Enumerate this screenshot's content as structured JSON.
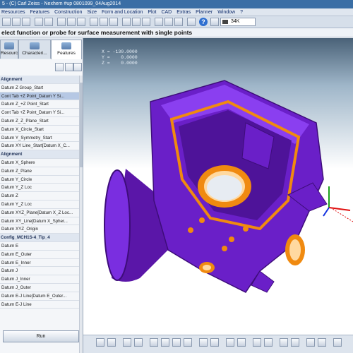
{
  "window": {
    "title": "5 - (C) Carl Zeiss - Nexhem #up 0801099_04Aug2014"
  },
  "menu": [
    "Resources",
    "Features",
    "Construction",
    "Size",
    "Form and Location",
    "Plot",
    "CAD",
    "Extras",
    "Planner",
    "Window",
    "?"
  ],
  "toolbar": {
    "combo_value": "34K"
  },
  "prompt": "elect function or probe for surface measurement with single points",
  "tabs": [
    "Resourc...",
    "Characteri...",
    "Features"
  ],
  "tree": [
    {
      "text": "Alignment",
      "kind": "section"
    },
    {
      "text": "Datum Z Group_Start",
      "kind": "item"
    },
    {
      "text": "Cont Tab +Z Point_Datum Y Si...",
      "kind": "selected"
    },
    {
      "text": "Datum Z_+Z Point_Start",
      "kind": "item"
    },
    {
      "text": "Cont Tab +Z Point_Datum Y Si...",
      "kind": "item"
    },
    {
      "text": "Datum Z_Z_Plane_Start",
      "kind": "item"
    },
    {
      "text": "Datum X_Circle_Start",
      "kind": "item"
    },
    {
      "text": "Datum Y_Symmetry_Start",
      "kind": "item"
    },
    {
      "text": "Datum XY Line_Start[Datum X_C...",
      "kind": "item"
    },
    {
      "text": "Alignment",
      "kind": "section"
    },
    {
      "text": "Datum X_Sphere",
      "kind": "item"
    },
    {
      "text": "Datum Z_Plane",
      "kind": "item"
    },
    {
      "text": "Datum Y_Circle",
      "kind": "item"
    },
    {
      "text": "Datum Y_Z Loc",
      "kind": "item"
    },
    {
      "text": "Datum Z",
      "kind": "item"
    },
    {
      "text": "Datum Y_Z Loc",
      "kind": "item"
    },
    {
      "text": "Datum XYZ_Plane[Datum X_Z Loc...",
      "kind": "item"
    },
    {
      "text": "Datum XY_Line[Datum X_Spher...",
      "kind": "item"
    },
    {
      "text": "Datum XYZ_Origin",
      "kind": "item"
    },
    {
      "text": "Config_MCH1S-4_Tip_4",
      "kind": "section"
    },
    {
      "text": "Datum E",
      "kind": "item"
    },
    {
      "text": "Datum E_Outer",
      "kind": "item"
    },
    {
      "text": "Datum E_Inner",
      "kind": "item"
    },
    {
      "text": "Datum J",
      "kind": "item"
    },
    {
      "text": "Datum J_Inner",
      "kind": "item"
    },
    {
      "text": "Datum J_Outer",
      "kind": "item"
    },
    {
      "text": "Datum E-J Line[Datum E_Outer...",
      "kind": "item"
    },
    {
      "text": "Datum E-J Line",
      "kind": "item"
    }
  ],
  "run_button": "Run",
  "viewport": {
    "coords": [
      "X = -130.0000",
      "Y =    0.0000",
      "Z =    0.0000"
    ],
    "part_color": "#6a1fc8",
    "bore_color": "#f08a10",
    "background_top": "#4a6278"
  }
}
